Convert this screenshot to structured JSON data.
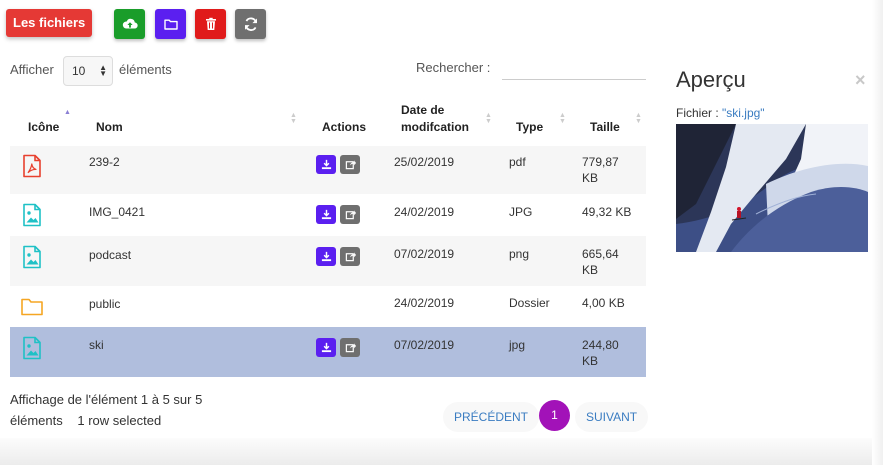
{
  "toolbar": {
    "brand_label": "Les fichiers",
    "buttons": [
      {
        "name": "upload",
        "icon": "cloud-upload-icon",
        "color": "#1a9d2a"
      },
      {
        "name": "new-folder",
        "icon": "folder-icon",
        "color": "#5b1ff0"
      },
      {
        "name": "delete",
        "icon": "trash-icon",
        "color": "#e01b1b"
      },
      {
        "name": "refresh",
        "icon": "refresh-icon",
        "color": "#6f6f6f"
      }
    ]
  },
  "table_controls": {
    "show_label": "Afficher",
    "page_length": "10",
    "page_length_suffix": "éléments",
    "search_label": "Rechercher :",
    "search_value": ""
  },
  "table": {
    "headers": {
      "icon": "Icône",
      "name": "Nom",
      "actions": "Actions",
      "date_line1": "Date de",
      "date_line2": "modifcation",
      "type": "Type",
      "size": "Taille"
    },
    "sorted_column": "icon",
    "rows": [
      {
        "icon": "pdf-file-icon",
        "name": "239-2",
        "has_actions": true,
        "date": "25/02/2019",
        "type": "pdf",
        "size_line1": "779,87",
        "size_line2": "KB",
        "selected": false
      },
      {
        "icon": "image-file-icon",
        "name": "IMG_0421",
        "has_actions": true,
        "date": "24/02/2019",
        "type": "JPG",
        "size_line1": "49,32 KB",
        "size_line2": "",
        "selected": false
      },
      {
        "icon": "image-file-icon",
        "name": "podcast",
        "has_actions": true,
        "date": "07/02/2019",
        "type": "png",
        "size_line1": "665,64",
        "size_line2": "KB",
        "selected": false
      },
      {
        "icon": "folder-icon",
        "name": "public",
        "has_actions": false,
        "date": "24/02/2019",
        "type": "Dossier",
        "size_line1": "4,00 KB",
        "size_line2": "",
        "selected": false
      },
      {
        "icon": "image-file-icon",
        "name": "ski",
        "has_actions": true,
        "date": "07/02/2019",
        "type": "jpg",
        "size_line1": "244,80",
        "size_line2": "KB",
        "selected": true
      }
    ]
  },
  "footer": {
    "info_line1": "Affichage de l'élément 1 à 5 sur 5",
    "info_line2": "éléments",
    "selection": "1 row selected",
    "prev_label": "PRÉCÉDENT",
    "page": "1",
    "next_label": "SUIVANT"
  },
  "preview": {
    "title": "Aperçu",
    "file_label": "Fichier : ",
    "file_name": "\"ski.jpg\"",
    "close_glyph": "×"
  },
  "colors": {
    "brand": "#e53935",
    "accent": "#5b1ff0",
    "page_active": "#a212b8",
    "selected_row": "#b0bedd",
    "link": "#3a7cc1"
  }
}
